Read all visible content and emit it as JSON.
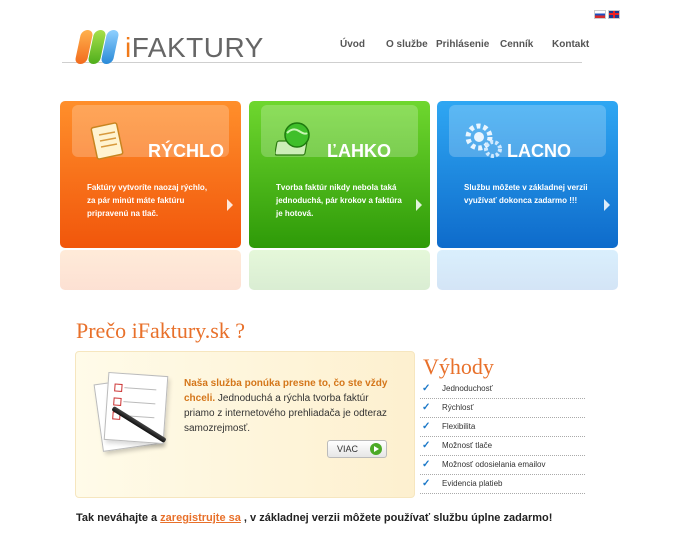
{
  "header": {
    "logo_prefix": "i",
    "logo_name": "FAKTURY",
    "nav": [
      "Úvod",
      "O službe",
      "Prihlásenie",
      "Cenník",
      "Kontakt"
    ],
    "flags": [
      "sk-flag-icon",
      "en-flag-icon"
    ]
  },
  "features": [
    {
      "title": "RÝCHLO",
      "text": "Faktúry vytvoríte naozaj rýchlo, za pár minút máte faktúru pripravenú na tlač.",
      "icon": "notepad-icon",
      "color": "#f5670f"
    },
    {
      "title": "ĽAHKO",
      "text": "Tvorba faktúr nikdy nebola taká jednoduchá, pár krokov a faktúra je hotová.",
      "icon": "globe-icon",
      "color": "#3aa515"
    },
    {
      "title": "LACNO",
      "text": "Službu môžete v základnej verzii využívať dokonca zadarmo !!!",
      "icon": "gear-icon",
      "color": "#1480dd"
    }
  ],
  "why": {
    "title": "Prečo iFaktury.sk ?",
    "lead": "Naša služba ponúka presne to, čo ste vždy chceli.",
    "text": " Jednoduchá a rýchla tvorba faktúr priamo z internetového prehliadača je odteraz samozrejmosť.",
    "more_label": "VIAC"
  },
  "benefits": {
    "title": "Výhody",
    "items": [
      "Jednoduchosť",
      "Rýchlosť",
      "Flexibilita",
      "Možnosť tlače",
      "Možnosť odosielania emailov",
      "Evidencia platieb"
    ]
  },
  "footer": {
    "before": "Tak neváhajte a ",
    "link": "zaregistrujte sa",
    "after": " , v základnej verzii môžete používať službu úplne zadarmo!"
  }
}
